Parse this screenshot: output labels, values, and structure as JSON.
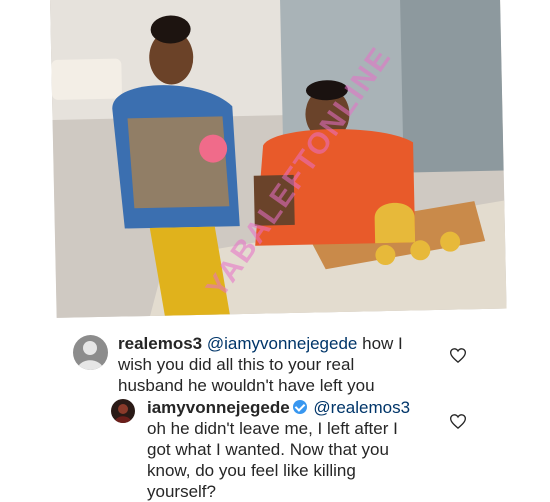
{
  "comments": [
    {
      "username": "realemos3",
      "mention": "@iamyvonnejegede",
      "line1_rest": " how I",
      "line2": "wish you did all this to your real",
      "line3": "husband he  wouldn't have left you"
    },
    {
      "username": "iamyvonnejegede",
      "mention": "@realemos3",
      "line2": "oh he didn't leave me, I left after I",
      "line3": "got what I wanted. Now that you",
      "line4": "know, do you feel like killing",
      "line5": "yourself?"
    }
  ],
  "icons": {
    "like": "heart-outline-icon",
    "verified": "verified-badge-icon"
  },
  "watermark": "YABALEFTONLINE",
  "colors": {
    "text": "#262626",
    "verified": "#3897f0",
    "mention": "#003569",
    "watermark": "#e870c8"
  }
}
